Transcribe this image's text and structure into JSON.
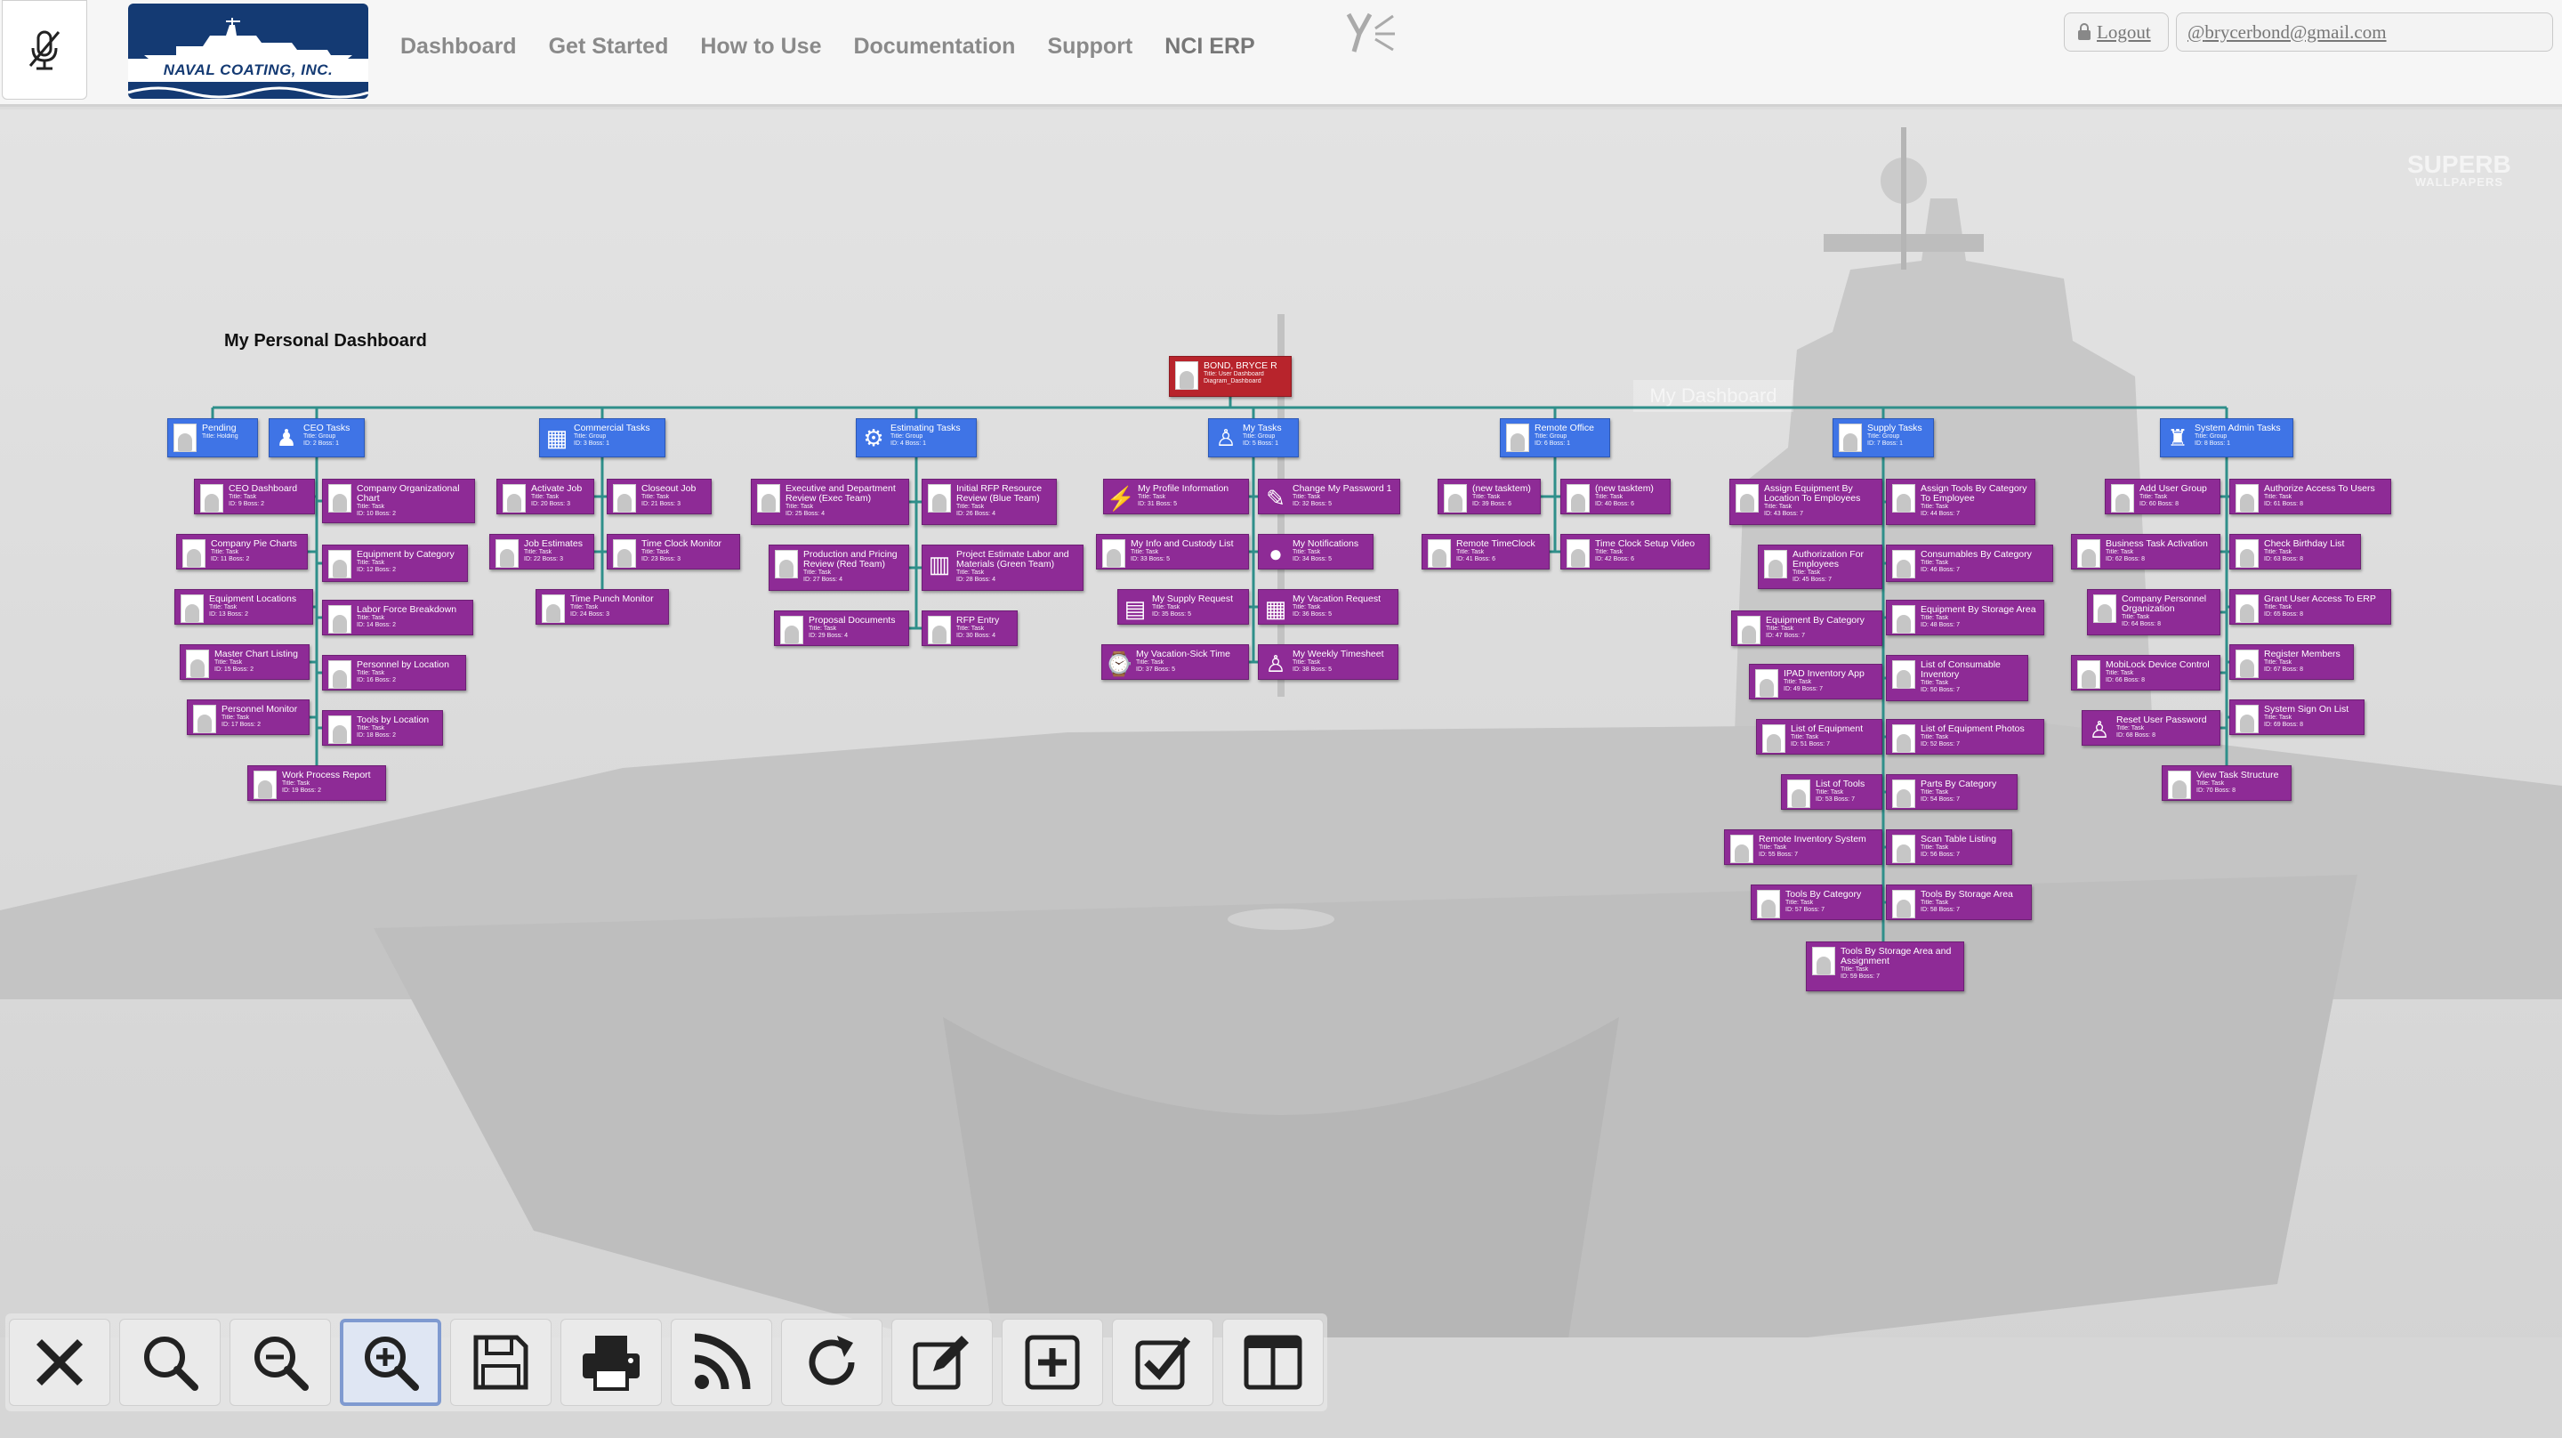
{
  "header": {
    "nav": [
      "Dashboard",
      "Get Started",
      "How to Use",
      "Documentation",
      "Support",
      "NCI ERP"
    ],
    "logo_text": "NAVAL COATING, INC.",
    "logout_label": "Logout",
    "email": "brycerbond@gmail.com",
    "icons": {
      "mic": "microphone-slash-icon",
      "brand": "yf-logo-icon",
      "lock": "lock-icon",
      "at": "at-sign-icon"
    }
  },
  "background": {
    "watermark_line1": "SUPERB",
    "watermark_line2": "WALLPAPERS",
    "ghost_title": "My Dashboard"
  },
  "dashboard": {
    "title": "My Personal Dashboard",
    "root": {
      "name": "BOND, BRYCE R",
      "meta1": "Title: User Dashboard",
      "meta2": "Diagram_Dashboard"
    },
    "groups": [
      {
        "name": "Pending",
        "meta": "Title: Holding"
      },
      {
        "name": "CEO Tasks",
        "meta": "Title: Group | ID: 2 Boss: 1"
      },
      {
        "name": "Commercial Tasks",
        "meta": "Title: Group | ID: 3 Boss: 1"
      },
      {
        "name": "Estimating Tasks",
        "meta": "Title: Group | ID: 4 Boss: 1"
      },
      {
        "name": "My Tasks",
        "meta": "Title: Group | ID: 5 Boss: 1"
      },
      {
        "name": "Remote Office",
        "meta": "Title: Group | ID: 6 Boss: 1"
      },
      {
        "name": "Supply Tasks",
        "meta": "Title: Group | ID: 7 Boss: 1"
      },
      {
        "name": "System Admin Tasks",
        "meta": "Title: Group | ID: 8 Boss: 1"
      }
    ],
    "tasks": [
      {
        "name": "CEO Dashboard",
        "meta": "Title: Task | ID: 9 Boss: 2"
      },
      {
        "name": "Company Organizational Chart",
        "meta": "Title: Task | ID: 10 Boss: 2"
      },
      {
        "name": "Company Pie Charts",
        "meta": "Title: Task | ID: 11 Boss: 2"
      },
      {
        "name": "Equipment by Category",
        "meta": "Title: Task | ID: 12 Boss: 2"
      },
      {
        "name": "Equipment Locations",
        "meta": "Title: Task | ID: 13 Boss: 2"
      },
      {
        "name": "Labor Force Breakdown",
        "meta": "Title: Task | ID: 14 Boss: 2"
      },
      {
        "name": "Master Chart Listing",
        "meta": "Title: Task | ID: 15 Boss: 2"
      },
      {
        "name": "Personnel by Location",
        "meta": "Title: Task | ID: 16 Boss: 2"
      },
      {
        "name": "Personnel Monitor",
        "meta": "Title: Task | ID: 17 Boss: 2"
      },
      {
        "name": "Tools by Location",
        "meta": "Title: Task | ID: 18 Boss: 2"
      },
      {
        "name": "Work Process Report",
        "meta": "Title: Task | ID: 19 Boss: 2"
      },
      {
        "name": "Activate Job",
        "meta": "Title: Task | ID: 20 Boss: 3"
      },
      {
        "name": "Closeout Job",
        "meta": "Title: Task | ID: 21 Boss: 3"
      },
      {
        "name": "Job Estimates",
        "meta": "Title: Task | ID: 22 Boss: 3"
      },
      {
        "name": "Time Clock Monitor",
        "meta": "Title: Task | ID: 23 Boss: 3"
      },
      {
        "name": "Time Punch Monitor",
        "meta": "Title: Task | ID: 24 Boss: 3"
      },
      {
        "name": "Executive and Department Review (Exec Team)",
        "meta": "Title: Task | ID: 25 Boss: 4"
      },
      {
        "name": "Initial RFP Resource Review (Blue Team)",
        "meta": "Title: Task | ID: 26 Boss: 4"
      },
      {
        "name": "Production and Pricing Review (Red Team)",
        "meta": "Title: Task | ID: 27 Boss: 4"
      },
      {
        "name": "Project Estimate Labor and Materials (Green Team)",
        "meta": "Title: Task | ID: 28 Boss: 4"
      },
      {
        "name": "Proposal Documents",
        "meta": "Title: Task | ID: 29 Boss: 4"
      },
      {
        "name": "RFP Entry",
        "meta": "Title: Task | ID: 30 Boss: 4"
      },
      {
        "name": "My Profile Information",
        "meta": "Title: Task | ID: 31 Boss: 5"
      },
      {
        "name": "Change My Password 1",
        "meta": "Title: Task | ID: 32 Boss: 5"
      },
      {
        "name": "My Info and Custody List",
        "meta": "Title: Task | ID: 33 Boss: 5"
      },
      {
        "name": "My Notifications",
        "meta": "Title: Task | ID: 34 Boss: 5"
      },
      {
        "name": "My Supply Request",
        "meta": "Title: Task | ID: 35 Boss: 5"
      },
      {
        "name": "My Vacation Request",
        "meta": "Title: Task | ID: 36 Boss: 5"
      },
      {
        "name": "My Vacation-Sick Time",
        "meta": "Title: Task | ID: 37 Boss: 5"
      },
      {
        "name": "My Weekly Timesheet",
        "meta": "Title: Task | ID: 38 Boss: 5"
      },
      {
        "name": "(new tasktem)",
        "meta": "Title: Task | ID: 39 Boss: 6"
      },
      {
        "name": "(new tasktem)",
        "meta": "Title: Task | ID: 40 Boss: 6"
      },
      {
        "name": "Remote TimeClock",
        "meta": "Title: Task | ID: 41 Boss: 6"
      },
      {
        "name": "Time Clock Setup Video",
        "meta": "Title: Task | ID: 42 Boss: 6"
      },
      {
        "name": "Assign Equipment By Location To Employees",
        "meta": "Title: Task | ID: 43 Boss: 7"
      },
      {
        "name": "Assign Tools By Category To Employee",
        "meta": "Title: Task | ID: 44 Boss: 7"
      },
      {
        "name": "Authorization For Employees",
        "meta": "Title: Task | ID: 45 Boss: 7"
      },
      {
        "name": "Consumables By Category",
        "meta": "Title: Task | ID: 46 Boss: 7"
      },
      {
        "name": "Equipment By Category",
        "meta": "Title: Task | ID: 47 Boss: 7"
      },
      {
        "name": "Equipment By Storage Area",
        "meta": "Title: Task | ID: 48 Boss: 7"
      },
      {
        "name": "IPAD Inventory App",
        "meta": "Title: Task | ID: 49 Boss: 7"
      },
      {
        "name": "List of Consumable Inventory",
        "meta": "Title: Task | ID: 50 Boss: 7"
      },
      {
        "name": "List of Equipment",
        "meta": "Title: Task | ID: 51 Boss: 7"
      },
      {
        "name": "List of Equipment Photos",
        "meta": "Title: Task | ID: 52 Boss: 7"
      },
      {
        "name": "List of Tools",
        "meta": "Title: Task | ID: 53 Boss: 7"
      },
      {
        "name": "Parts By Category",
        "meta": "Title: Task | ID: 54 Boss: 7"
      },
      {
        "name": "Remote Inventory System",
        "meta": "Title: Task | ID: 55 Boss: 7"
      },
      {
        "name": "Scan Table Listing",
        "meta": "Title: Task | ID: 56 Boss: 7"
      },
      {
        "name": "Tools By Category",
        "meta": "Title: Task | ID: 57 Boss: 7"
      },
      {
        "name": "Tools By Storage Area",
        "meta": "Title: Task | ID: 58 Boss: 7"
      },
      {
        "name": "Tools By Storage Area and Assignment",
        "meta": "Title: Task | ID: 59 Boss: 7"
      },
      {
        "name": "Add User Group",
        "meta": "Title: Task | ID: 60 Boss: 8"
      },
      {
        "name": "Authorize Access To Users",
        "meta": "Title: Task | ID: 61 Boss: 8"
      },
      {
        "name": "Business Task Activation",
        "meta": "Title: Task | ID: 62 Boss: 8"
      },
      {
        "name": "Check Birthday List",
        "meta": "Title: Task | ID: 63 Boss: 8"
      },
      {
        "name": "Company Personnel Organization",
        "meta": "Title: Task | ID: 64 Boss: 8"
      },
      {
        "name": "Grant User Access To ERP",
        "meta": "Title: Task | ID: 65 Boss: 8"
      },
      {
        "name": "MobiLock Device Control",
        "meta": "Title: Task | ID: 66 Boss: 8"
      },
      {
        "name": "Register Members",
        "meta": "Title: Task | ID: 67 Boss: 8"
      },
      {
        "name": "Reset User Password",
        "meta": "Title: Task | ID: 68 Boss: 8"
      },
      {
        "name": "System Sign On List",
        "meta": "Title: Task | ID: 69 Boss: 8"
      },
      {
        "name": "View Task Structure",
        "meta": "Title: Task | ID: 70 Boss: 8"
      }
    ]
  },
  "toolbar": {
    "buttons": [
      "close-icon",
      "search-icon",
      "zoom-out-icon",
      "zoom-in-icon",
      "save-icon",
      "print-icon",
      "rss-icon",
      "refresh-icon",
      "edit-icon",
      "add-icon",
      "checkbox-icon",
      "layout-icon"
    ],
    "active": "zoom-in-icon"
  },
  "colors": {
    "task": "#8e2b96",
    "group": "#3f74e6",
    "root": "#b8242c",
    "connector": "#2f8f8a",
    "nav_text": "#8a8a8a"
  }
}
